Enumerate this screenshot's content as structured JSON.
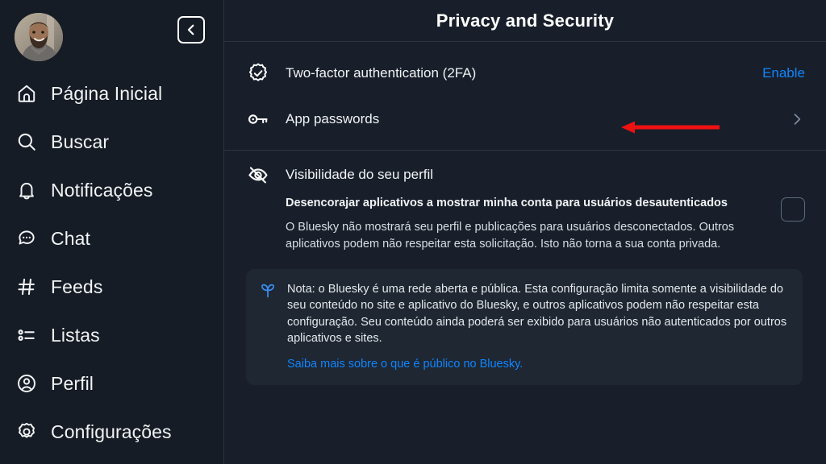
{
  "sidebar": {
    "avatar": {
      "name": "user-avatar"
    },
    "back_button": {
      "icon": "chevron-left-icon"
    },
    "items": [
      {
        "label": "Página Inicial",
        "icon": "home-icon",
        "key": "home"
      },
      {
        "label": "Buscar",
        "icon": "search-icon",
        "key": "search"
      },
      {
        "label": "Notificações",
        "icon": "bell-icon",
        "key": "notifications"
      },
      {
        "label": "Chat",
        "icon": "chat-bubble-icon",
        "key": "chat"
      },
      {
        "label": "Feeds",
        "icon": "hash-icon",
        "key": "feeds"
      },
      {
        "label": "Listas",
        "icon": "list-icon",
        "key": "lists"
      },
      {
        "label": "Perfil",
        "icon": "user-circle-icon",
        "key": "profile"
      },
      {
        "label": "Configurações",
        "icon": "gear-icon",
        "key": "settings"
      }
    ]
  },
  "header": {
    "title": "Privacy and Security"
  },
  "security": {
    "two_factor": {
      "label": "Two-factor authentication (2FA)",
      "icon": "verified-badge-icon",
      "action_label": "Enable"
    },
    "app_passwords": {
      "label": "App passwords",
      "icon": "key-icon",
      "chevron": "chevron-right-icon"
    }
  },
  "visibility": {
    "title": "Visibilidade do seu perfil",
    "icon": "eye-off-icon",
    "toggle_label": "Desencorajar aplicativos a mostrar minha conta para usuários desautenticados",
    "description": "O Bluesky não mostrará seu perfil e publicações para usuários desconectados. Outros aplicativos podem não respeitar esta solicitação. Isto não torna a sua conta privada.",
    "checkbox_checked": false
  },
  "note": {
    "icon": "bluesky-sprout-icon",
    "text": "Nota: o Bluesky é uma rede aberta e pública. Esta configuração limita somente a visibilidade do seu conteúdo no site e aplicativo do Bluesky, e outros aplicativos podem não respeitar esta configuração. Seu conteúdo ainda poderá ser exibido para usuários não autenticados por outros aplicativos e sites.",
    "link_label": "Saiba mais sobre o que é público no Bluesky."
  },
  "annotation": {
    "type": "arrow",
    "direction": "left",
    "color": "#ee1111",
    "points_at": "App passwords"
  },
  "colors": {
    "accent": "#1185fe",
    "sidebar_bg": "#161c25",
    "main_bg": "#181f2a",
    "note_bg": "#1e2732",
    "divider": "#2b3541",
    "text": "#f1f3f5",
    "annotation": "#ee1111"
  }
}
